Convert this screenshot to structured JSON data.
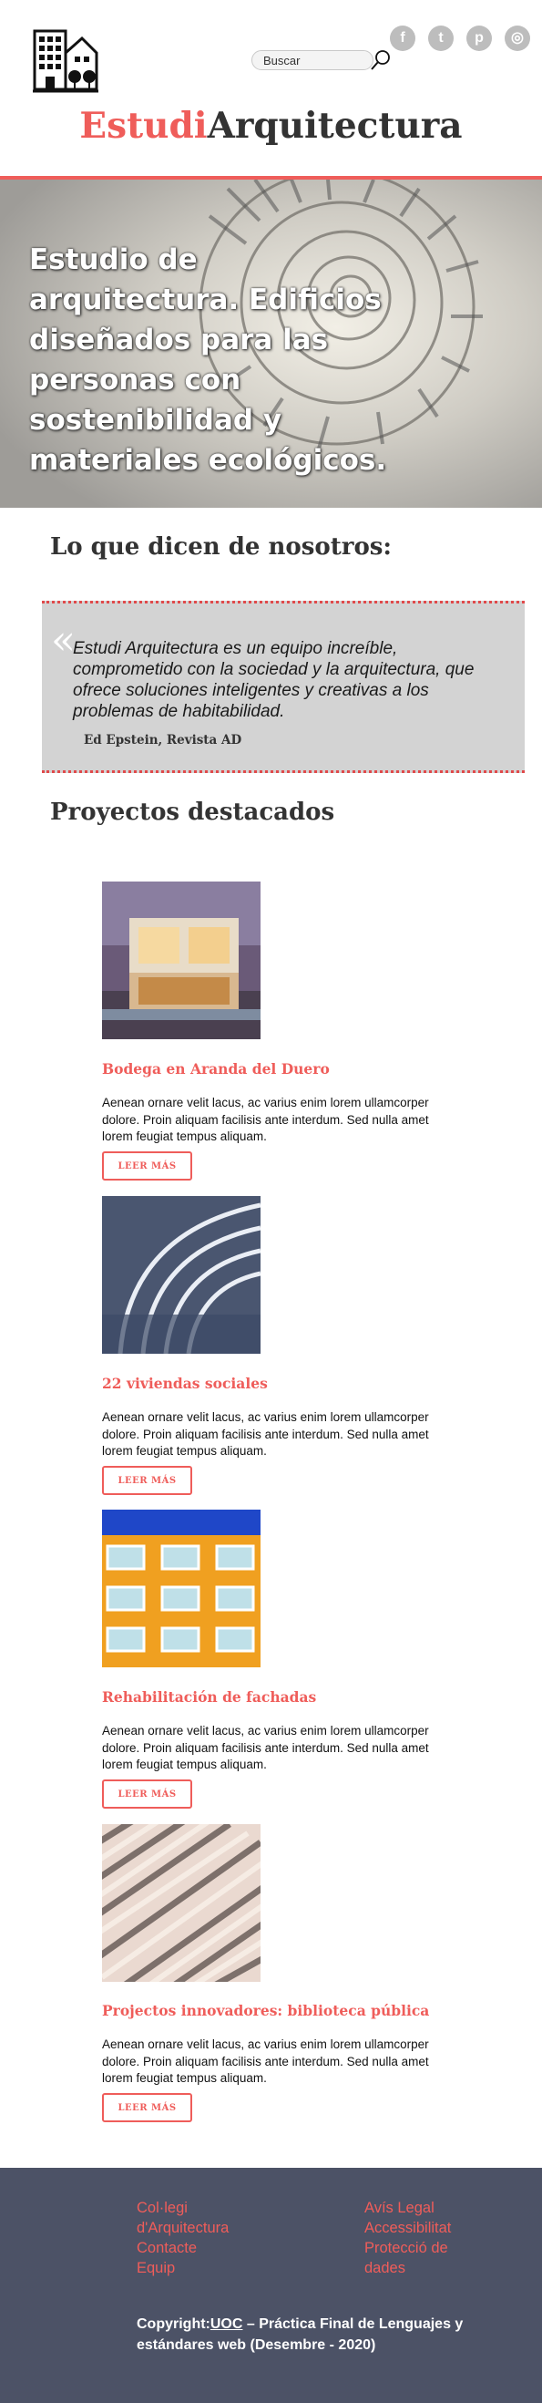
{
  "header": {
    "logo_icon": "building-icon",
    "search": {
      "placeholder": "Buscar"
    },
    "social": [
      {
        "name": "facebook",
        "glyph": "f"
      },
      {
        "name": "twitter",
        "glyph": "t"
      },
      {
        "name": "pinterest",
        "glyph": "p"
      },
      {
        "name": "instagram",
        "glyph": "◎"
      }
    ],
    "brand_accent": "Estudi",
    "brand_main": "Arquitectura"
  },
  "hero": {
    "title": "Estudio de arquitectura. Edificios diseñados para las personas con sostenibilidad y materiales ecológicos."
  },
  "testimonials": {
    "heading": "Lo que dicen de nosotros:",
    "quote_mark": "«",
    "quote": "Estudi Arquitectura es un equipo increíble, comprometido con la sociedad y la arquitectura, que ofrece soluciones inteligentes y creativas a los problemas de habitabilidad.",
    "author": "Ed Epstein, Revista AD"
  },
  "projects": {
    "heading": "Proyectos destacados",
    "items": [
      {
        "title": "Bodega en Aranda del Duero",
        "description": "Aenean ornare velit lacus, ac varius enim lorem ullamcorper dolore. Proin aliquam facilisis ante interdum. Sed nulla amet lorem feugiat tempus aliquam.",
        "button": "LEER MÁS"
      },
      {
        "title": "22 viviendas sociales",
        "description": "Aenean ornare velit lacus, ac varius enim lorem ullamcorper dolore. Proin aliquam facilisis ante interdum. Sed nulla amet lorem feugiat tempus aliquam.",
        "button": "LEER MÁS"
      },
      {
        "title": "Rehabilitación de fachadas",
        "description": "Aenean ornare velit lacus, ac varius enim lorem ullamcorper dolore. Proin aliquam facilisis ante interdum. Sed nulla amet lorem feugiat tempus aliquam.",
        "button": "LEER MÁS"
      },
      {
        "title": "Projectos innovadores: biblioteca pública",
        "description": "Aenean ornare velit lacus, ac varius enim lorem ullamcorper dolore. Proin aliquam facilisis ante interdum. Sed nulla amet lorem feugiat tempus aliquam.",
        "button": "LEER MÁS"
      }
    ]
  },
  "footer": {
    "left_links": [
      "Col·legi d'Arquitectura",
      "Contacte",
      "Equip"
    ],
    "right_links": [
      "Avís Legal",
      "Accessibilitat",
      "Protecció de dades"
    ],
    "copyright_prefix": "Copyright:",
    "copyright_org": "UOC",
    "copyright_rest": " – Práctica Final de Lenguajes y estándares web (Desembre - 2020)"
  },
  "colors": {
    "accent": "#ef5d5a",
    "footer_bg": "#4c5266",
    "quote_bg": "#d3d3d3"
  }
}
